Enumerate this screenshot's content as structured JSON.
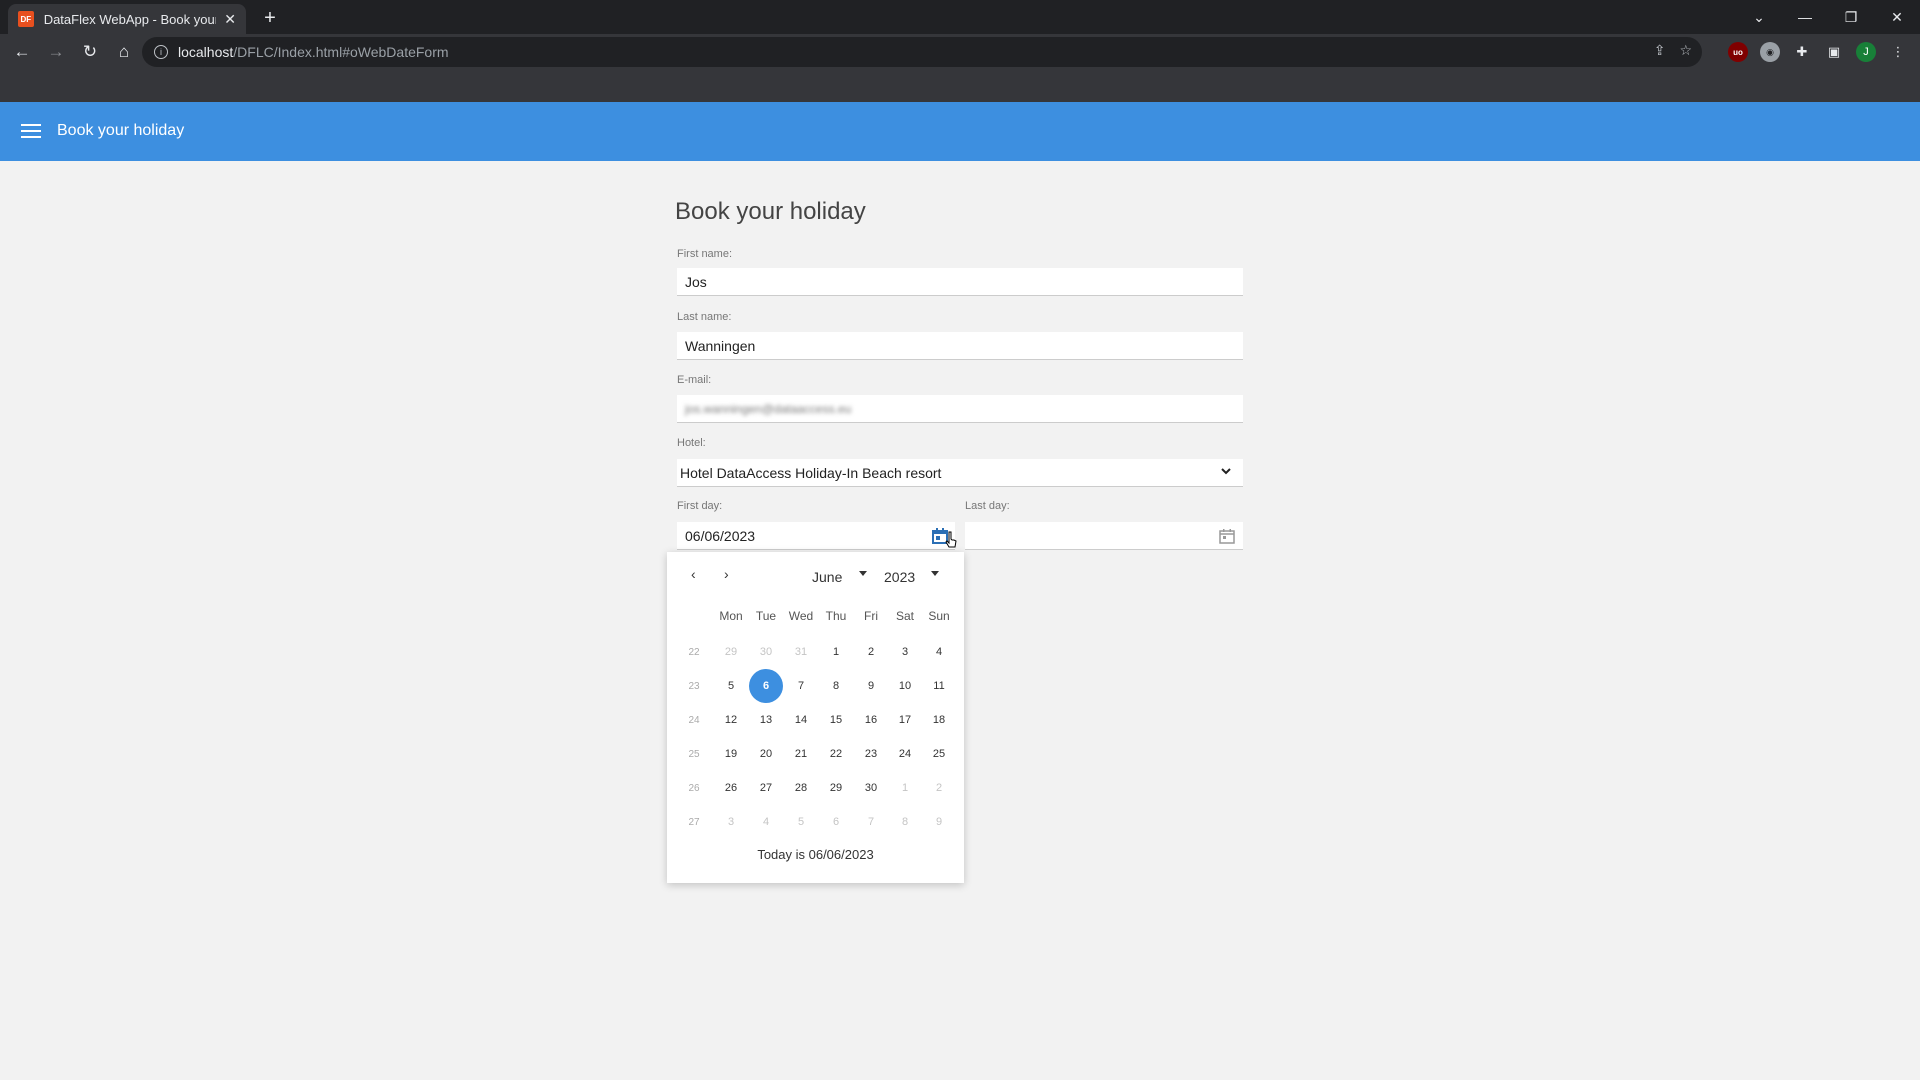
{
  "browser": {
    "tab_title": "DataFlex WebApp - Book your holiday",
    "favicon_text": "DF",
    "url_host": "localhost",
    "url_path": "/DFLC/Index.html#oWebDateForm",
    "profile_initial": "J",
    "ext_ublock_text": "uo"
  },
  "app": {
    "header_title": "Book your holiday",
    "accent_color": "#3d8fe0"
  },
  "form": {
    "title": "Book your holiday",
    "first_name_label": "First name:",
    "first_name_value": "Jos",
    "last_name_label": "Last name:",
    "last_name_value": "Wanningen",
    "email_label": "E-mail:",
    "email_value": "jos.wanningen@dataaccess.eu",
    "hotel_label": "Hotel:",
    "hotel_value": "Hotel DataAccess Holiday-In Beach resort",
    "first_day_label": "First day:",
    "first_day_value": "06/06/2023",
    "last_day_label": "Last day:",
    "last_day_value": ""
  },
  "datepicker": {
    "month": "June",
    "year": "2023",
    "days_of_week": [
      "Mon",
      "Tue",
      "Wed",
      "Thu",
      "Fri",
      "Sat",
      "Sun"
    ],
    "weeks": [
      {
        "wk": "22",
        "days": [
          [
            "29",
            true
          ],
          [
            "30",
            true
          ],
          [
            "31",
            true
          ],
          [
            "1",
            false
          ],
          [
            "2",
            false
          ],
          [
            "3",
            false
          ],
          [
            "4",
            false
          ]
        ]
      },
      {
        "wk": "23",
        "days": [
          [
            "5",
            false
          ],
          [
            "6",
            false
          ],
          [
            "7",
            false
          ],
          [
            "8",
            false
          ],
          [
            "9",
            false
          ],
          [
            "10",
            false
          ],
          [
            "11",
            false
          ]
        ]
      },
      {
        "wk": "24",
        "days": [
          [
            "12",
            false
          ],
          [
            "13",
            false
          ],
          [
            "14",
            false
          ],
          [
            "15",
            false
          ],
          [
            "16",
            false
          ],
          [
            "17",
            false
          ],
          [
            "18",
            false
          ]
        ]
      },
      {
        "wk": "25",
        "days": [
          [
            "19",
            false
          ],
          [
            "20",
            false
          ],
          [
            "21",
            false
          ],
          [
            "22",
            false
          ],
          [
            "23",
            false
          ],
          [
            "24",
            false
          ],
          [
            "25",
            false
          ]
        ]
      },
      {
        "wk": "26",
        "days": [
          [
            "26",
            false
          ],
          [
            "27",
            false
          ],
          [
            "28",
            false
          ],
          [
            "29",
            false
          ],
          [
            "30",
            false
          ],
          [
            "1",
            true
          ],
          [
            "2",
            true
          ]
        ]
      },
      {
        "wk": "27",
        "days": [
          [
            "3",
            true
          ],
          [
            "4",
            true
          ],
          [
            "5",
            true
          ],
          [
            "6",
            true
          ],
          [
            "7",
            true
          ],
          [
            "8",
            true
          ],
          [
            "9",
            true
          ]
        ]
      }
    ],
    "selected_day": "6",
    "today_text": "Today is 06/06/2023"
  }
}
